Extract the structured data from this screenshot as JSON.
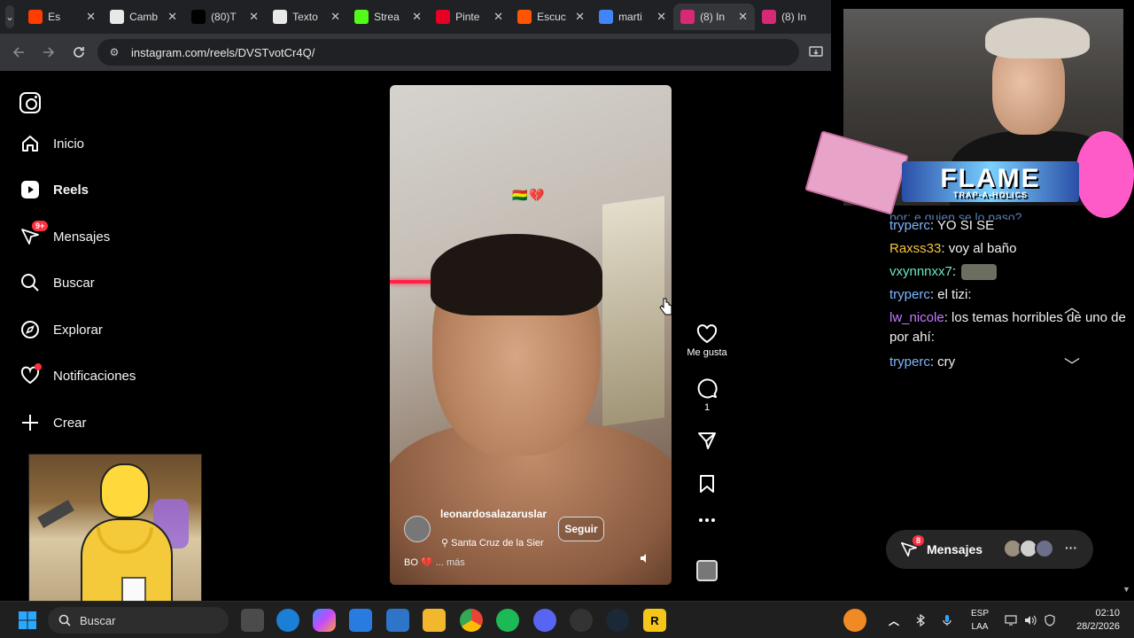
{
  "browser": {
    "tabs": [
      {
        "label": "Es",
        "icon": "youtube-studio-icon",
        "color": "#ff3d00"
      },
      {
        "label": "Camb",
        "icon": "chatgpt-icon",
        "color": "#e8e8e8"
      },
      {
        "label": "(80)T",
        "icon": "tiktok-icon",
        "color": "#000000"
      },
      {
        "label": "Texto",
        "icon": "chatgpt-icon",
        "color": "#e8e8e8"
      },
      {
        "label": "Strea",
        "icon": "kick-icon",
        "color": "#53fc18"
      },
      {
        "label": "Pinte",
        "icon": "pinterest-icon",
        "color": "#e60023"
      },
      {
        "label": "Escuc",
        "icon": "soundcloud-icon",
        "color": "#ff5500"
      },
      {
        "label": "marti",
        "icon": "google-icon",
        "color": "#4285f4"
      },
      {
        "label": "(8) In",
        "icon": "instagram-icon",
        "color": "#d62976"
      },
      {
        "label": "(8) In",
        "icon": "instagram-icon",
        "color": "#d62976"
      }
    ],
    "url": "instagram.com/reels/DVSTvotCr4Q/"
  },
  "sidebar": {
    "items": [
      {
        "label": "Inicio",
        "icon": "home-icon"
      },
      {
        "label": "Reels",
        "icon": "reels-icon"
      },
      {
        "label": "Mensajes",
        "icon": "messenger-icon",
        "badge": "9+"
      },
      {
        "label": "Buscar",
        "icon": "search-icon"
      },
      {
        "label": "Explorar",
        "icon": "compass-icon"
      },
      {
        "label": "Notificaciones",
        "icon": "heart-icon"
      },
      {
        "label": "Crear",
        "icon": "plus-icon"
      }
    ]
  },
  "reel": {
    "emoji_text": "🇧🇴💔",
    "author": "leonardosalazaruslar",
    "location": "Santa Cruz de la Sier",
    "follow_label": "Seguir",
    "caption": "BO 💔",
    "more_label": "... más"
  },
  "actions": {
    "like_label": "Me gusta",
    "comment_count": "1"
  },
  "stream": {
    "logo_text": "FLAME",
    "logo_sub": "TRAP-A-HOLICS",
    "chat": [
      {
        "user": "tryperc",
        "user_color": "#7eb6ff",
        "text": ": YO SI SE"
      },
      {
        "user": "Raxss33",
        "user_color": "#f5c542",
        "text": ": voy al baño"
      },
      {
        "user": "vxynnnxx7",
        "user_color": "#6be8c8",
        "text": ":"
      },
      {
        "user": "tryperc",
        "user_color": "#7eb6ff",
        "text": ": el tizi:"
      },
      {
        "user": "lw_nicole",
        "user_color": "#c77dff",
        "text": ": los temas horribles de uno de por ahí:"
      },
      {
        "user": "tryperc",
        "user_color": "#7eb6ff",
        "text": ": cry"
      }
    ],
    "partial_top": "por: e quien se lo paso?"
  },
  "messages_pill": {
    "label": "Mensajes",
    "badge": "8"
  },
  "taskbar": {
    "search_placeholder": "Buscar",
    "lang_1": "ESP",
    "lang_2": "LAA",
    "time": "02:10",
    "date": "28/2/2026"
  }
}
